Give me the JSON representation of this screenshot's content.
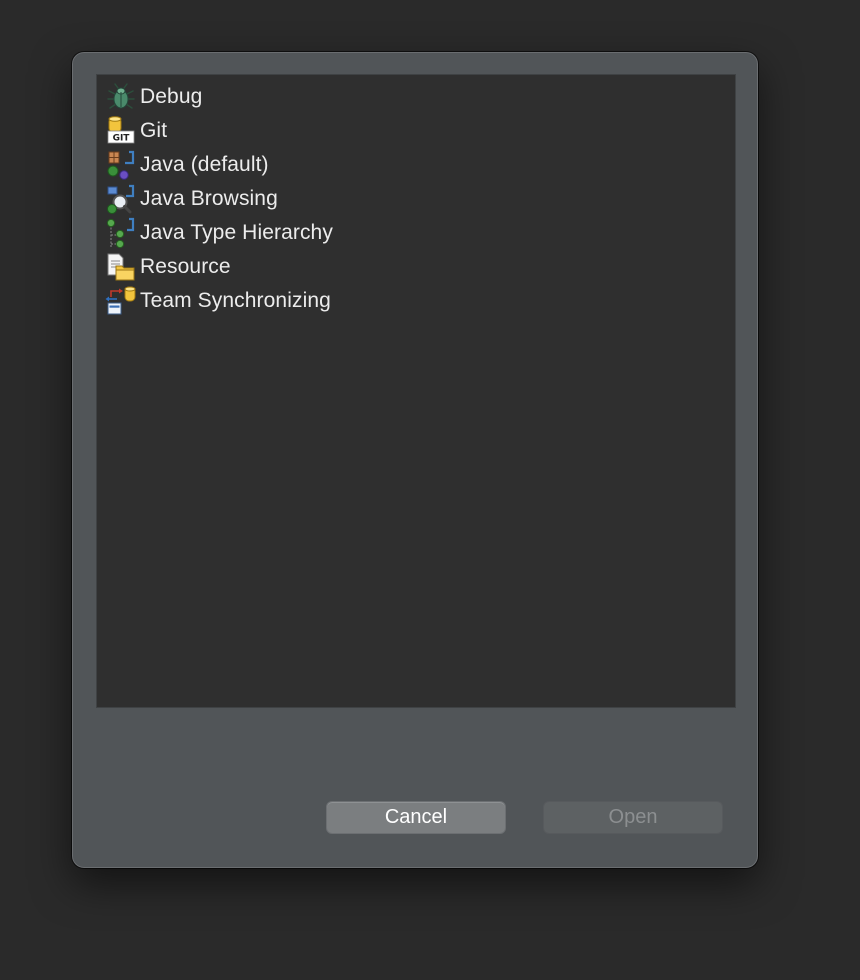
{
  "dialog": {
    "perspectives": [
      {
        "label": "Debug",
        "icon": "debug-bug-icon"
      },
      {
        "label": "Git",
        "icon": "git-repository-icon"
      },
      {
        "label": "Java (default)",
        "icon": "java-perspective-icon"
      },
      {
        "label": "Java Browsing",
        "icon": "java-browsing-icon"
      },
      {
        "label": "Java Type Hierarchy",
        "icon": "type-hierarchy-icon"
      },
      {
        "label": "Resource",
        "icon": "resource-folder-icon"
      },
      {
        "label": "Team Synchronizing",
        "icon": "team-sync-icon"
      }
    ],
    "buttons": {
      "cancel_label": "Cancel",
      "open_label": "Open",
      "open_enabled": false
    }
  }
}
